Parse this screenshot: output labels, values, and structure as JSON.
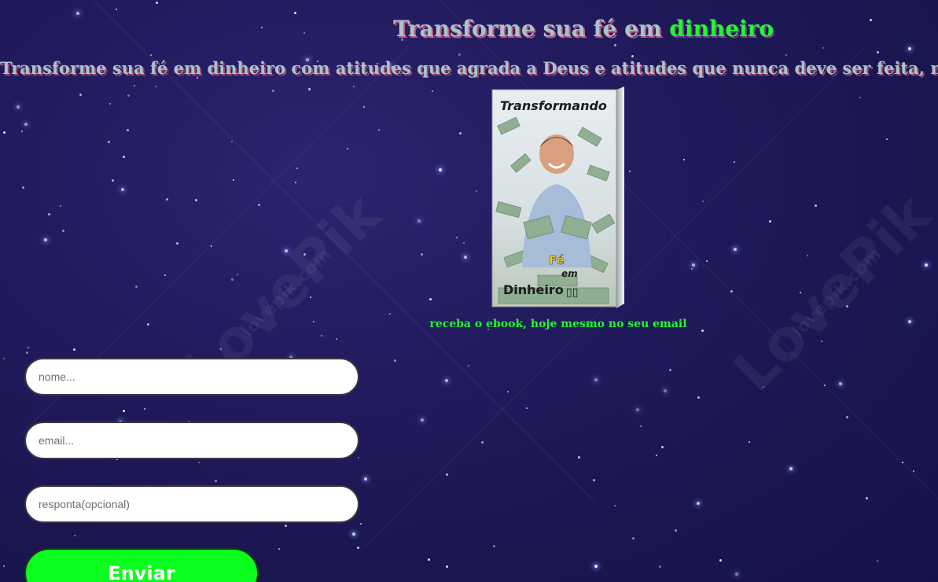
{
  "header": {
    "title_main": "Transforme sua fé em ",
    "title_accent": "dinheiro",
    "subtitle": "Transforme sua fé em dinheiro com atitudes que agrada a Deus e atitudes que nunca deve ser feita, na area de négocios"
  },
  "ebook": {
    "cover_title": "Transformando",
    "cover_word_fe": "Fé",
    "cover_word_em": "em",
    "cover_word_dinheiro": "Dinheiro",
    "cover_glyphs": "▯▯",
    "caption": "receba o ebook, hoje mesmo no seu email"
  },
  "form": {
    "name_placeholder": "nome...",
    "email_placeholder": "email...",
    "answer_placeholder": "responta(opcional)",
    "submit_label": "Enviar"
  },
  "background": {
    "watermark_text": "LovePik",
    "watermark_sub": "lovepik.com"
  },
  "colors": {
    "accent_green": "#1dff2a",
    "button_green": "#0bff1e",
    "title_text": "#a9c4c9",
    "background": "#1f1a5a"
  }
}
